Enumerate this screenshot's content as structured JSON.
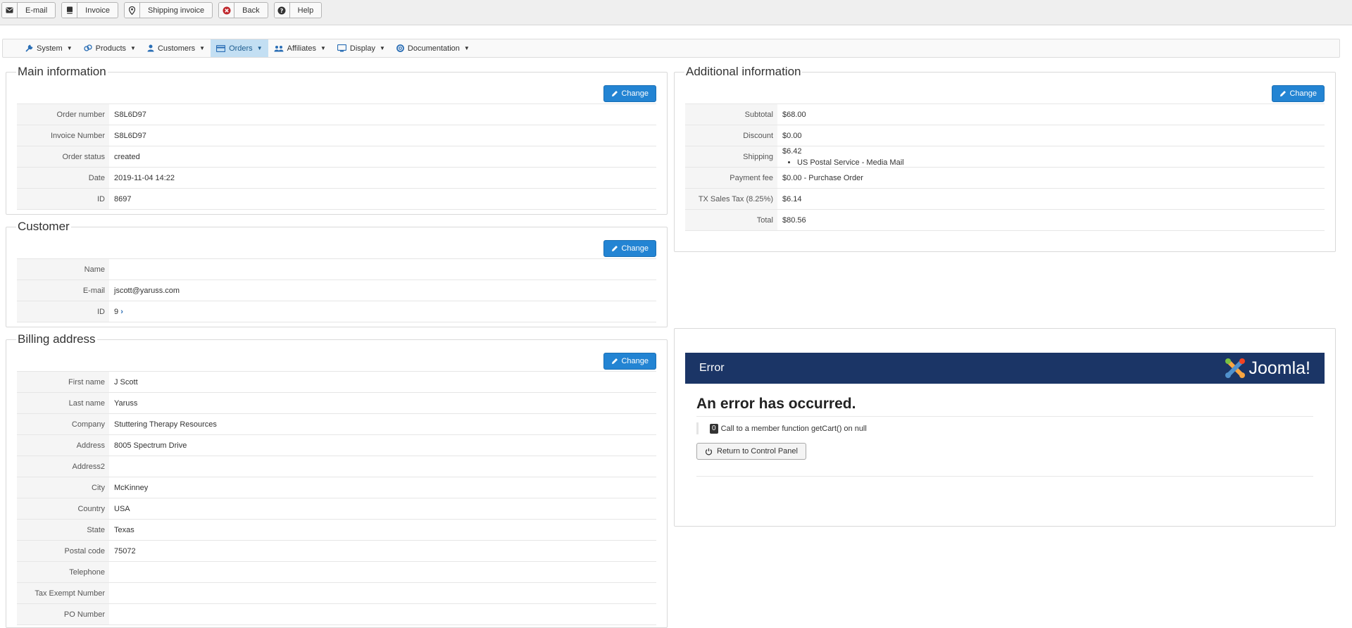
{
  "toolbar": {
    "email_label": "E-mail",
    "invoice_label": "Invoice",
    "shipping_invoice_label": "Shipping invoice",
    "back_label": "Back",
    "help_label": "Help"
  },
  "menu": {
    "items": [
      {
        "label": "System",
        "icon": "wrench-icon"
      },
      {
        "label": "Products",
        "icon": "products-icon"
      },
      {
        "label": "Customers",
        "icon": "user-icon"
      },
      {
        "label": "Orders",
        "icon": "credit-card-icon",
        "active": true
      },
      {
        "label": "Affiliates",
        "icon": "users-icon"
      },
      {
        "label": "Display",
        "icon": "monitor-icon"
      },
      {
        "label": "Documentation",
        "icon": "lifebuoy-icon"
      }
    ]
  },
  "main_info": {
    "title": "Main information",
    "change_label": "Change",
    "rows": [
      {
        "label": "Order number",
        "value": "S8L6D97"
      },
      {
        "label": "Invoice Number",
        "value": "S8L6D97"
      },
      {
        "label": "Order status",
        "value": "created"
      },
      {
        "label": "Date",
        "value": "2019-11-04 14:22"
      },
      {
        "label": "ID",
        "value": "8697"
      }
    ]
  },
  "customer": {
    "title": "Customer",
    "change_label": "Change",
    "rows": [
      {
        "label": "Name",
        "value": ""
      },
      {
        "label": "E-mail",
        "value": "jscott@yaruss.com"
      },
      {
        "label": "ID",
        "value": "9"
      }
    ]
  },
  "billing": {
    "title": "Billing address",
    "change_label": "Change",
    "rows": [
      {
        "label": "First name",
        "value": "J Scott"
      },
      {
        "label": "Last name",
        "value": "Yaruss"
      },
      {
        "label": "Company",
        "value": "Stuttering Therapy Resources"
      },
      {
        "label": "Address",
        "value": "8005 Spectrum Drive"
      },
      {
        "label": "Address2",
        "value": ""
      },
      {
        "label": "City",
        "value": "McKinney"
      },
      {
        "label": "Country",
        "value": "USA"
      },
      {
        "label": "State",
        "value": "Texas"
      },
      {
        "label": "Postal code",
        "value": "75072"
      },
      {
        "label": "Telephone",
        "value": ""
      },
      {
        "label": "Tax Exempt Number",
        "value": ""
      },
      {
        "label": "PO Number",
        "value": ""
      }
    ]
  },
  "additional": {
    "title": "Additional information",
    "change_label": "Change",
    "rows": [
      {
        "label": "Subtotal",
        "value": "$68.00"
      },
      {
        "label": "Discount",
        "value": "$0.00"
      },
      {
        "label": "Shipping",
        "value": "$6.42",
        "detail": "US Postal Service - Media Mail"
      },
      {
        "label": "Payment fee",
        "value": "$0.00 - Purchase Order"
      },
      {
        "label": "TX Sales Tax (8.25%)",
        "value": "$6.14"
      },
      {
        "label": "Total",
        "value": "$80.56"
      }
    ]
  },
  "error": {
    "header": "Error",
    "logo_text": "Joomla!",
    "heading": "An error has occurred.",
    "code": "0",
    "message": "Call to a member function getCart() on null",
    "return_label": "Return to Control Panel"
  },
  "colors": {
    "primary_button": "#2384d3",
    "error_header": "#1b3566",
    "active_menu": "#c3dff3"
  }
}
